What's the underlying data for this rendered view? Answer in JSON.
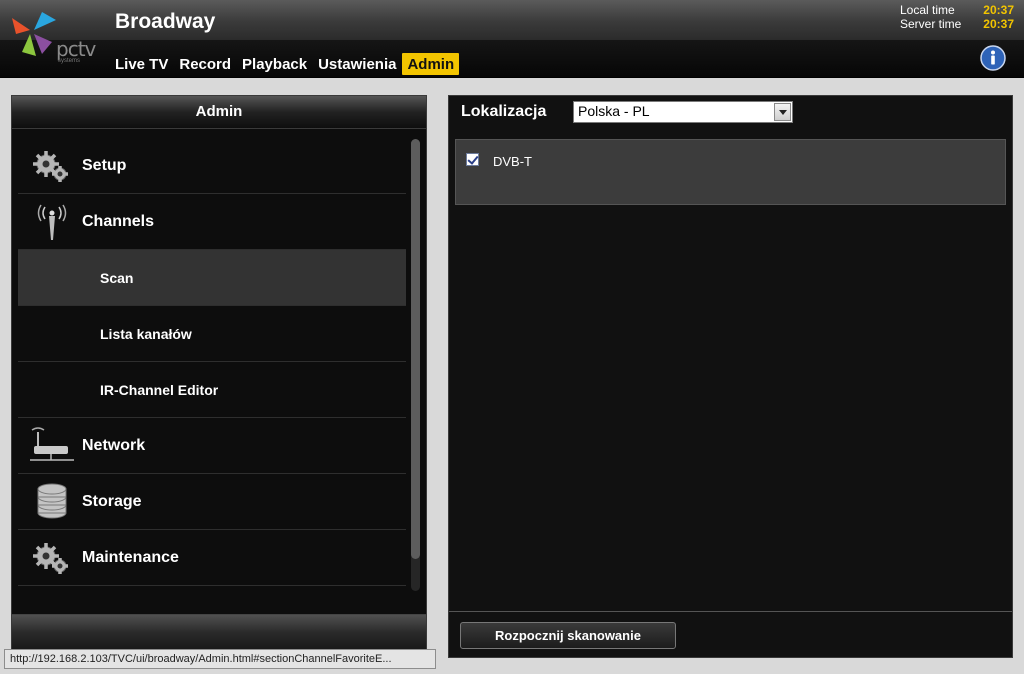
{
  "header": {
    "app_title": "Broadway",
    "logo_text": "pctv",
    "logo_sub": "systems",
    "clock": {
      "local_label": "Local time",
      "local_value": "20:37",
      "server_label": "Server time",
      "server_value": "20:37"
    },
    "nav": [
      {
        "label": "Live TV",
        "active": false
      },
      {
        "label": "Record",
        "active": false
      },
      {
        "label": "Playback",
        "active": false
      },
      {
        "label": "Ustawienia",
        "active": false
      },
      {
        "label": "Admin",
        "active": true
      }
    ],
    "info_icon": "info-icon"
  },
  "left_panel": {
    "title": "Admin",
    "menu": [
      {
        "label": "Setup",
        "icon": "gears-icon",
        "level": 0
      },
      {
        "label": "Channels",
        "icon": "antenna-icon",
        "level": 0
      },
      {
        "label": "Scan",
        "level": 1,
        "selected": true
      },
      {
        "label": "Lista kanałów",
        "level": 1
      },
      {
        "label": "IR-Channel Editor",
        "level": 1
      },
      {
        "label": "Network",
        "icon": "network-router-icon",
        "level": 0
      },
      {
        "label": "Storage",
        "icon": "database-icon",
        "level": 0
      },
      {
        "label": "Maintenance",
        "icon": "gears-icon",
        "level": 0
      }
    ]
  },
  "right_panel": {
    "location_label": "Lokalizacja",
    "location_value": "Polska - PL",
    "standards": [
      {
        "label": "DVB-T",
        "checked": true
      }
    ],
    "scan_button": "Rozpocznij skanowanie"
  },
  "status_bar": {
    "url": "http://192.168.2.103/TVC/ui/broadway/Admin.html#sectionChannelFavoriteE..."
  },
  "colors": {
    "accent": "#f2c400",
    "panel_bg": "#0d0d0d",
    "selected_row": "#333333"
  }
}
